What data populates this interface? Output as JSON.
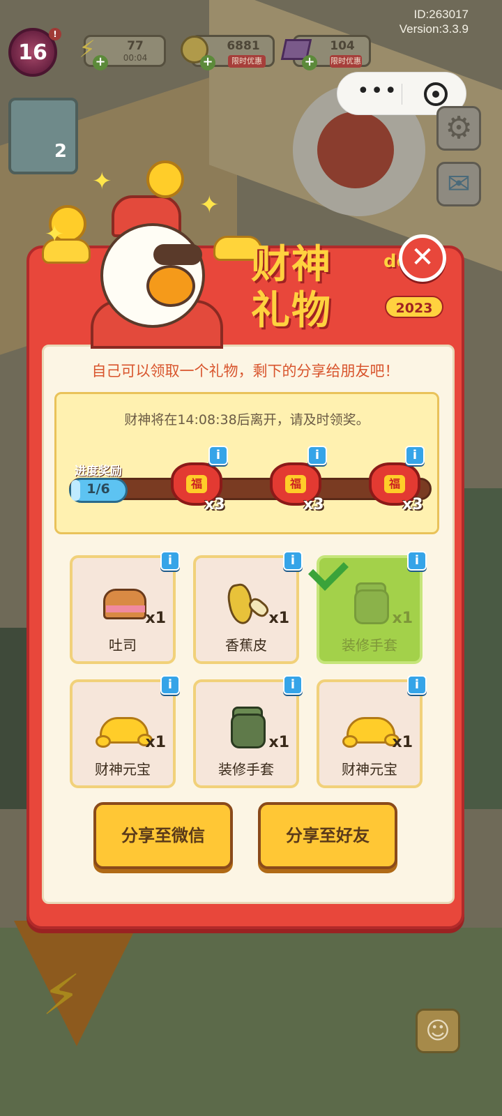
{
  "hud": {
    "id_text": "ID:263017",
    "version_text": "Version:3.3.9",
    "level": "16",
    "level_alert": "!",
    "energy": {
      "value": "77",
      "timer": "00:04"
    },
    "coins": {
      "value": "6881",
      "tag": "限时优惠"
    },
    "gems": {
      "value": "104",
      "tag": "限时优惠"
    },
    "task_count": "2"
  },
  "modal": {
    "title_line1": "财神",
    "title_de": "de",
    "title_line2": "礼物",
    "year": "2023",
    "close_label": "✕",
    "instruction": "自己可以领取一个礼物，剩下的分享给朋友吧！",
    "timer_text": "财神将在14:08:38后离开，请及时领奖。",
    "progress": {
      "label": "进度奖励",
      "count": "1/6",
      "fraction": 0.1667,
      "rewards": [
        {
          "icon": "lucky-bag",
          "glyph": "福",
          "qty": "x3"
        },
        {
          "icon": "lucky-bag",
          "glyph": "福",
          "qty": "x3"
        },
        {
          "icon": "lucky-bag",
          "glyph": "福",
          "qty": "x3"
        }
      ]
    },
    "gifts": [
      {
        "name": "吐司",
        "qty": "x1",
        "icon": "toast",
        "claimed": false
      },
      {
        "name": "香蕉皮",
        "qty": "x1",
        "icon": "banana-peel",
        "claimed": false
      },
      {
        "name": "装修手套",
        "qty": "x1",
        "icon": "glove",
        "claimed": true
      },
      {
        "name": "财神元宝",
        "qty": "x1",
        "icon": "gold-ingot",
        "claimed": false
      },
      {
        "name": "装修手套",
        "qty": "x1",
        "icon": "glove",
        "claimed": false
      },
      {
        "name": "财神元宝",
        "qty": "x1",
        "icon": "gold-ingot",
        "claimed": false
      }
    ],
    "info_glyph": "i",
    "share_wechat": "分享至微信",
    "share_friends": "分享至好友"
  },
  "colors": {
    "modal_red": "#e8473b",
    "panel_cream": "#fcf5e4",
    "button_yellow": "#ffc735",
    "info_blue": "#35a4e8",
    "claimed_green": "#a3d14a"
  }
}
